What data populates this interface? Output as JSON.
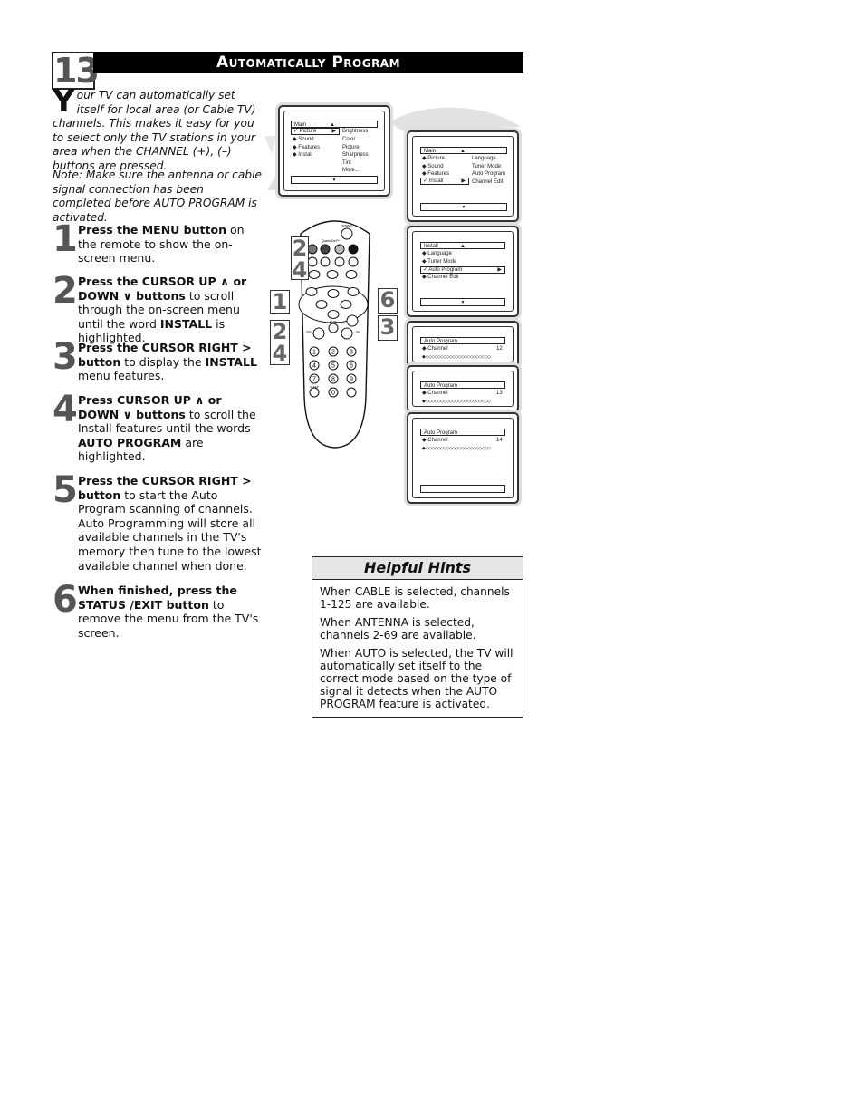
{
  "header": {
    "page_number": "13",
    "title": "Automatically Program"
  },
  "intro": {
    "drop_cap": "Y",
    "text": "our TV can automatically set itself for local area (or Cable TV) channels. This makes it easy for you to select only the TV stations in your area when the CHANNEL (+), (–) buttons are pressed.",
    "note": "Note: Make sure the antenna or cable signal connection has been completed before AUTO PROGRAM is activated."
  },
  "steps": [
    {
      "num": "1",
      "bold": "Press the MENU button",
      "rest": " on the remote to show the on-screen menu."
    },
    {
      "num": "2",
      "bold": "Press the CURSOR UP ∧ or DOWN ∨ buttons",
      "rest": " to scroll through the on-screen menu until the word ",
      "bold2": "INSTALL",
      "rest2": " is highlighted."
    },
    {
      "num": "3",
      "bold": "Press the CURSOR RIGHT > button",
      "rest": " to display the ",
      "bold2": "INSTALL",
      "rest2": " menu features."
    },
    {
      "num": "4",
      "bold": "Press CURSOR UP ∧ or DOWN ∨ buttons",
      "rest": " to scroll the Install features until the words ",
      "bold2": "AUTO PROGRAM",
      "rest2": " are highlighted."
    },
    {
      "num": "5",
      "bold": "Press the CURSOR RIGHT > button",
      "rest": " to start the Auto Program scanning of channels. Auto Programming will store all available channels in the TV's memory then tune to the lowest available channel when done."
    },
    {
      "num": "6",
      "bold": "When finished, press the STATUS /EXIT button",
      "rest": " to remove the menu from the TV's screen."
    }
  ],
  "screens": {
    "main_picture": {
      "header": "Main",
      "up": "▲",
      "down": "▼",
      "items": [
        "✓ Picture",
        "◆ Sound",
        "◆ Features",
        "◆ Install"
      ],
      "sub_items": [
        "Brightness",
        "Color",
        "Picture",
        "Sharpness",
        "Tint",
        "More..."
      ]
    },
    "main_install": {
      "header": "Main",
      "up": "▲",
      "down": "▼",
      "items": [
        "◆ Picture",
        "◆ Sound",
        "◆ Features",
        "✓ Install"
      ],
      "sub_items": [
        "Language",
        "Tuner Mode",
        "Auto Program",
        "Channel Edit"
      ]
    },
    "install": {
      "header": "Install",
      "up": "▲",
      "down": "▼",
      "items": [
        "◆ Language",
        "◆ Tuner Mode",
        "✓ Auto Program",
        "◆ Channel Edit"
      ]
    },
    "auto_program": [
      {
        "header": "Auto Program",
        "label": "◆ Channel",
        "channel": "12",
        "progress": "◆  ◇◇◇◇◇◇◇◇◇◇◇◇◇◇◇◇◇◇◇◇◇◇"
      },
      {
        "header": "Auto Program",
        "label": "◆ Channel",
        "channel": "13",
        "progress": "◆  ◇◇◇◇◇◇◇◇◇◇◇◇◇◇◇◇◇◇◇◇◇◇"
      },
      {
        "header": "Auto Program",
        "label": "◆ Channel",
        "channel": "14",
        "progress": "◆  ◇◇◇◇◇◇◇◇◇◇◇◇◇◇◇◇◇◇◇◇◇◇"
      }
    ]
  },
  "remote": {
    "power_label": "POWER",
    "quadra_label": "QuadraSurf™",
    "menu_label": "MENU",
    "status_label": "STATUS EXIT",
    "mute_label": "MUTE",
    "vol_label": "VOL",
    "ch_label": "CH",
    "sleep_label": "SLEEP",
    "digits": [
      "1",
      "2",
      "3",
      "4",
      "5",
      "6",
      "7",
      "8",
      "9",
      "",
      "0",
      ""
    ],
    "quadra_colors": [
      "#777777",
      "#444444",
      "#bbbbbb",
      "#111111"
    ]
  },
  "callouts": {
    "up": [
      "2",
      "4"
    ],
    "menu": "1",
    "status": "6",
    "right": "3",
    "down": [
      "2",
      "4"
    ]
  },
  "hints": {
    "title": "Helpful Hints",
    "items": [
      "When CABLE is selected, channels 1-125 are available.",
      "When ANTENNA is selected, channels 2-69 are available.",
      "When AUTO is selected, the TV will automatically set itself to the correct mode based on the type of signal it detects when the AUTO PROGRAM feature is activated."
    ]
  }
}
